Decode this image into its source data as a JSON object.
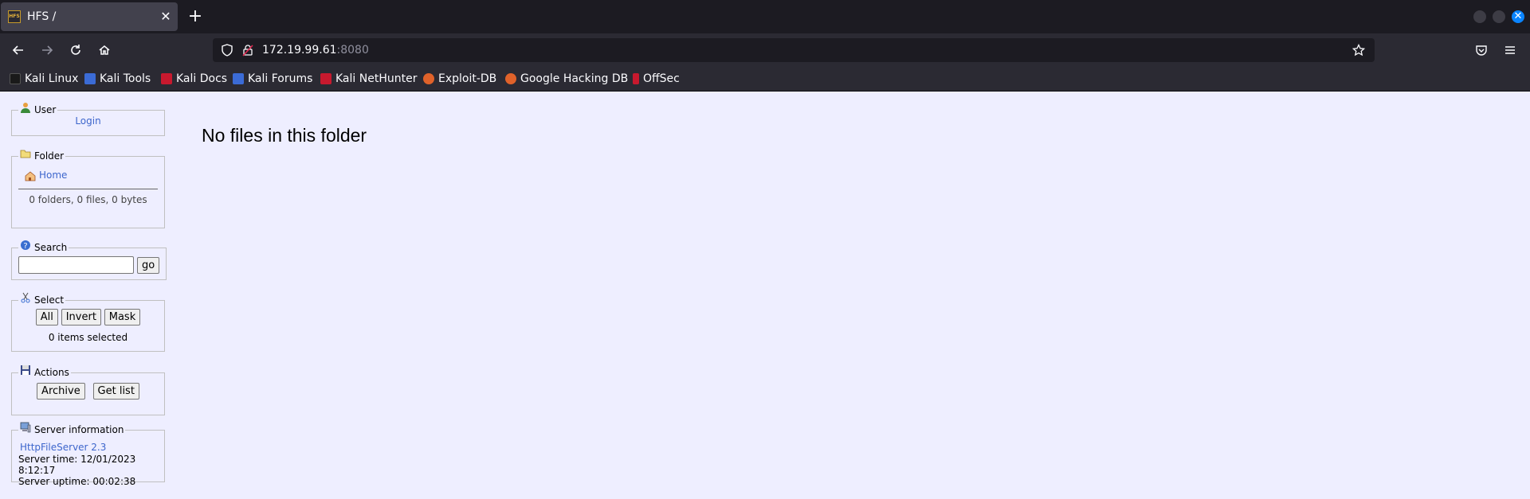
{
  "browser": {
    "tab_title": "HFS /",
    "tab_favicon_text": "HFS",
    "url_host": "172.19.99.61",
    "url_port": ":8080",
    "bookmarks": [
      {
        "label": "Kali Linux",
        "color": "#1a1a1a"
      },
      {
        "label": "Kali Tools",
        "color": "#3b6bd6"
      },
      {
        "label": "Kali Docs",
        "color": "#c8192e"
      },
      {
        "label": "Kali Forums",
        "color": "#3b6bd6"
      },
      {
        "label": "Kali NetHunter",
        "color": "#c8192e"
      },
      {
        "label": "Exploit-DB",
        "color": "#e0622a"
      },
      {
        "label": "Google Hacking DB",
        "color": "#e0622a"
      },
      {
        "label": "OffSec",
        "color": "#c8192e"
      }
    ]
  },
  "sidebar": {
    "user": {
      "legend": "User",
      "login_link": "Login"
    },
    "folder": {
      "legend": "Folder",
      "home_link": "Home",
      "summary": "0 folders, 0 files, 0 bytes"
    },
    "search": {
      "legend": "Search",
      "input_value": "",
      "go_label": "go"
    },
    "select": {
      "legend": "Select",
      "all_label": "All",
      "invert_label": "Invert",
      "mask_label": "Mask",
      "status": "0 items selected"
    },
    "actions": {
      "legend": "Actions",
      "archive_label": "Archive",
      "getlist_label": "Get list"
    },
    "server": {
      "legend": "Server information",
      "version_link": "HttpFileServer 2.3",
      "server_time": "Server time: 12/01/2023 8:12:17",
      "server_uptime": "Server uptime: 00:02:38"
    }
  },
  "main": {
    "message": "No files in this folder"
  }
}
